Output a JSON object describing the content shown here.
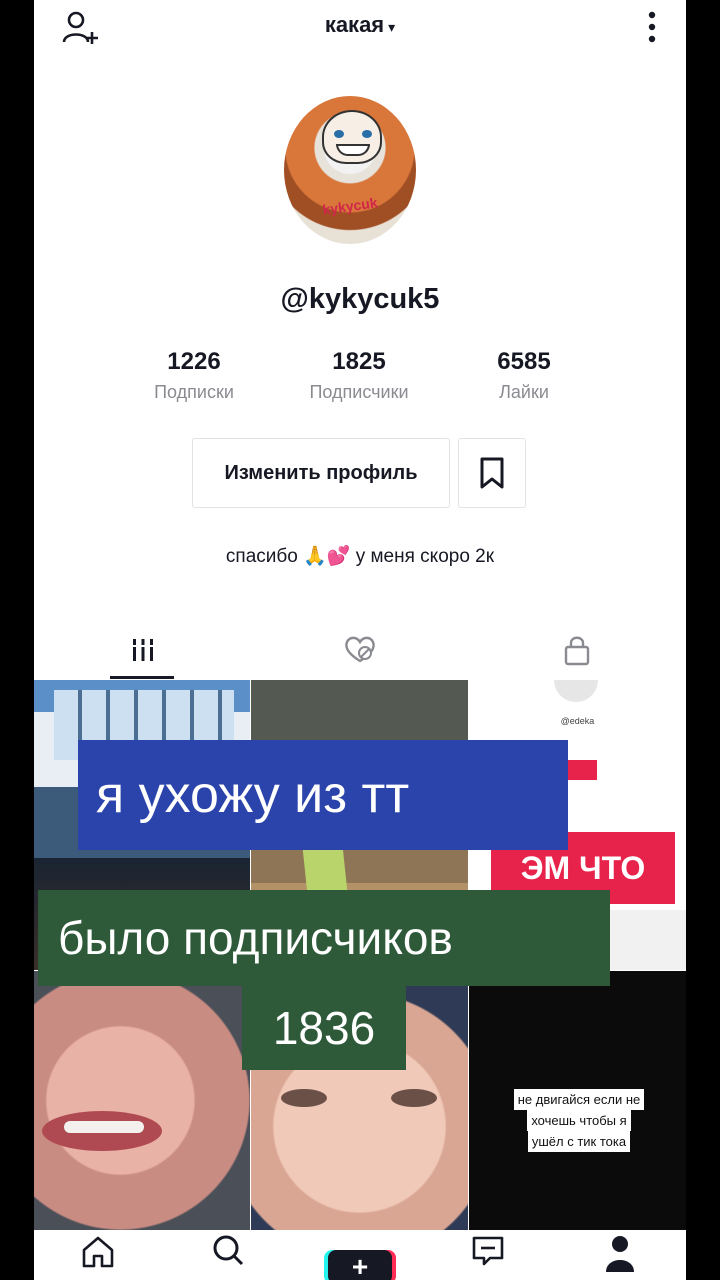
{
  "header": {
    "title": "какая",
    "title_caret": "▾"
  },
  "profile": {
    "username": "@kykycuk5",
    "avatar_tag": "kykycuk",
    "bio": "спасибо 🙏💕 у меня скоро 2к"
  },
  "stats": [
    {
      "value": "1226",
      "label": "Подписки"
    },
    {
      "value": "1825",
      "label": "Подписчики"
    },
    {
      "value": "6585",
      "label": "Лайки"
    }
  ],
  "actions": {
    "edit_profile": "Изменить профиль"
  },
  "tabs": [
    {
      "icon": "grid-icon",
      "active": true
    },
    {
      "icon": "liked-hidden-icon",
      "active": false
    },
    {
      "icon": "lock-icon",
      "active": false
    }
  ],
  "grid": {
    "cell3": {
      "mini_name": "@edeka",
      "banner": "ЭМ ЧТО"
    },
    "cell6": {
      "note_lines": [
        "не двигайся если не",
        "хочешь чтобы я",
        "ушёл с тик тока"
      ]
    }
  },
  "overlays": {
    "line1": "я ухожу из тт",
    "line2": "было подписчиков",
    "line3": "1836"
  },
  "bottom_nav": [
    {
      "icon": "home-icon"
    },
    {
      "icon": "search-icon"
    },
    {
      "icon": "plus-icon",
      "label": "+"
    },
    {
      "icon": "inbox-icon"
    },
    {
      "icon": "profile-icon"
    }
  ],
  "colors": {
    "text": "#161823",
    "muted": "#8a8b91",
    "accent_red": "#e8234b",
    "overlay_blue": "#2b44ab",
    "overlay_green": "#2e5a3a"
  }
}
